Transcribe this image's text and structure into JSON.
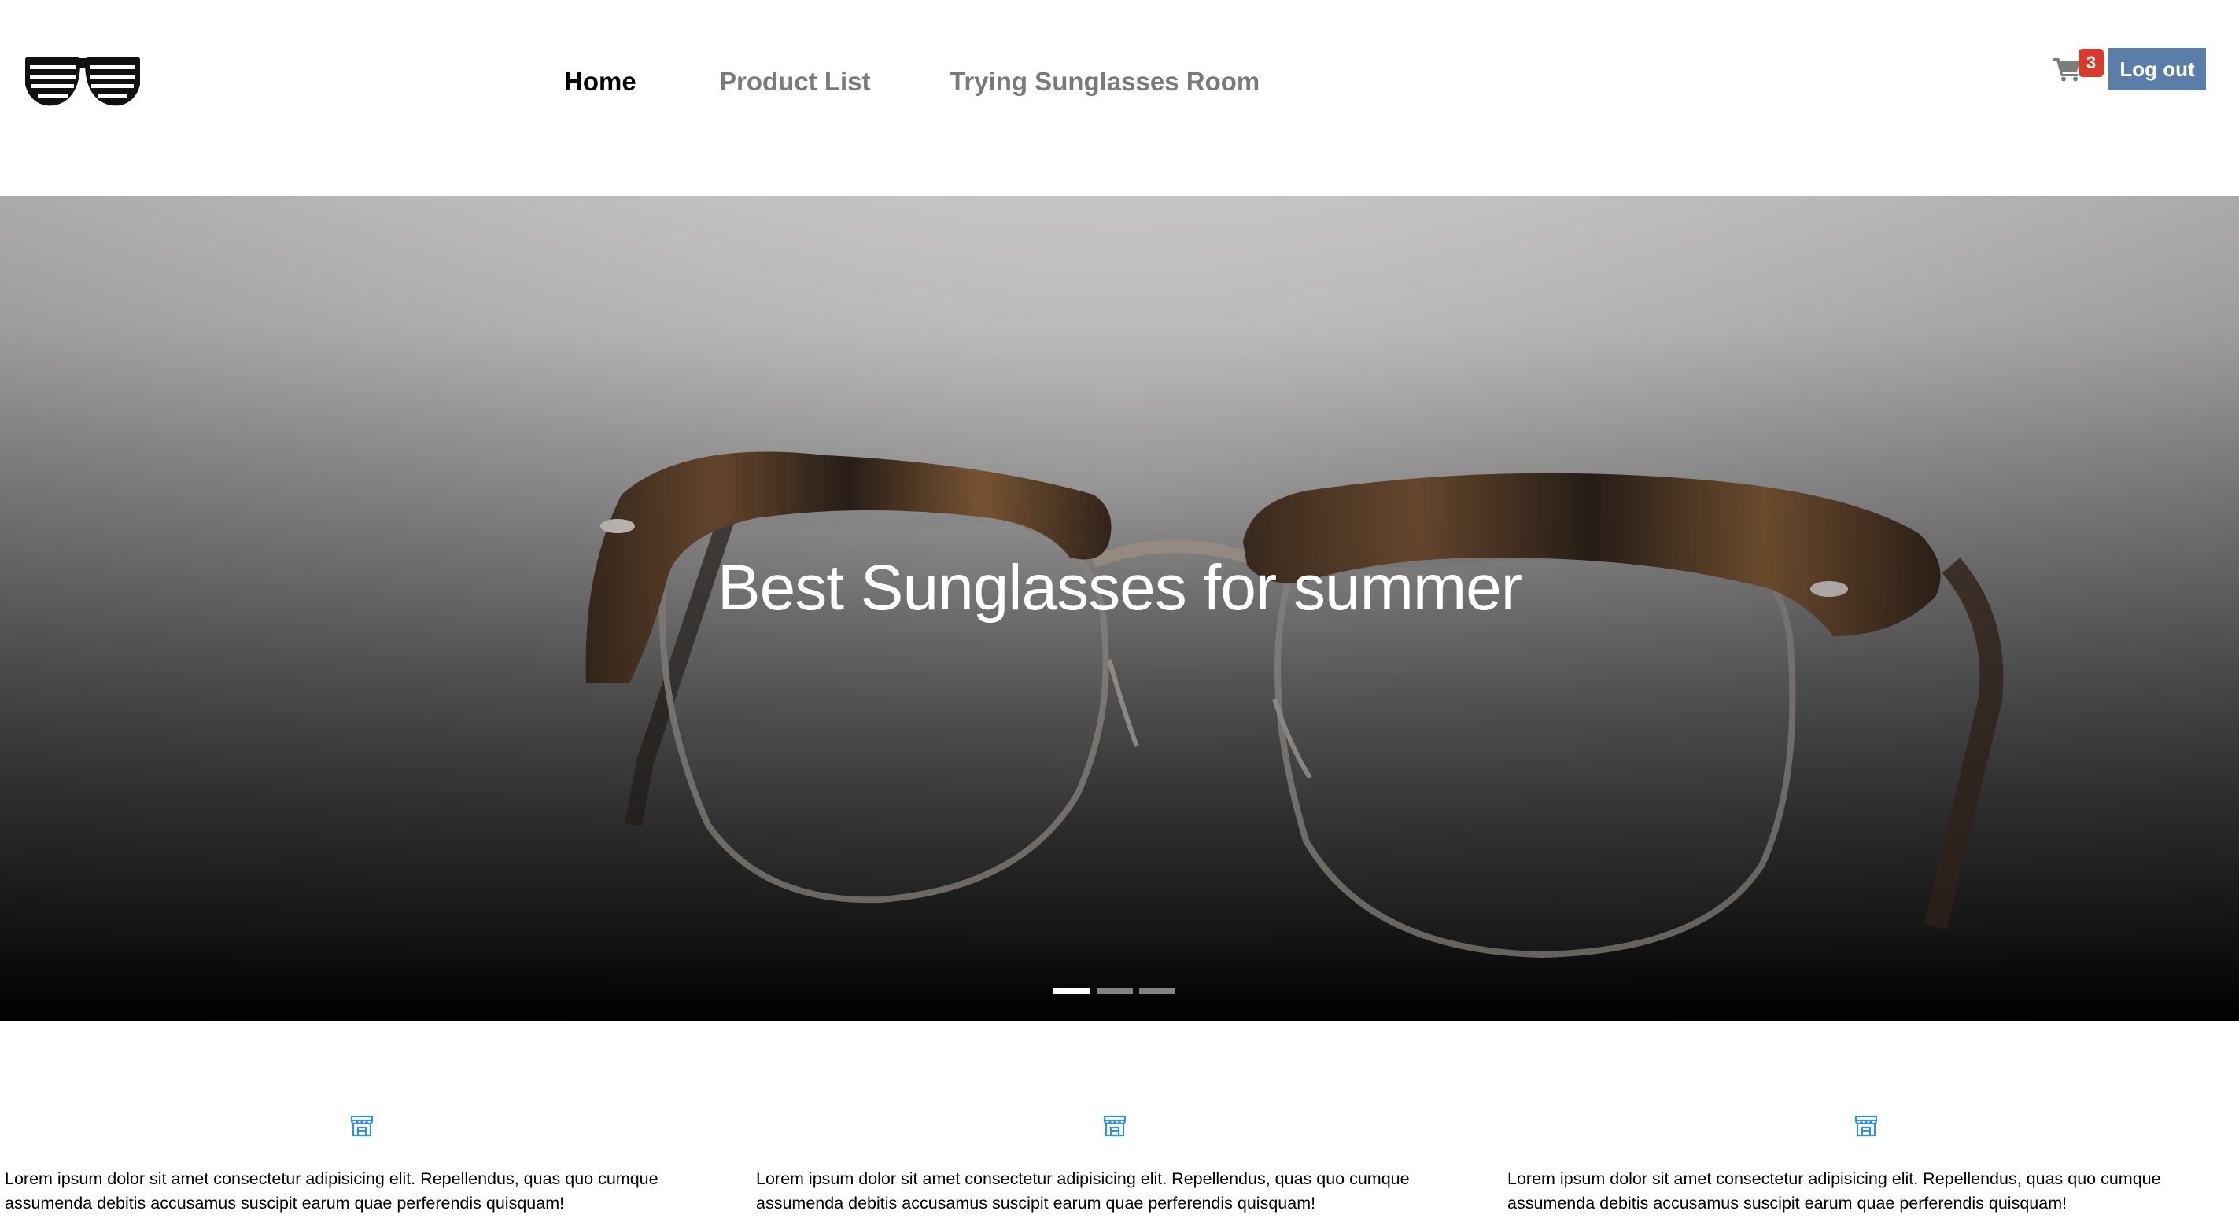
{
  "brand": {
    "logo_icon": "sunglasses-logo-icon"
  },
  "nav": {
    "items": [
      {
        "label": "Home",
        "active": true
      },
      {
        "label": "Product List",
        "active": false
      },
      {
        "label": "Trying Sunglasses Room",
        "active": false
      }
    ]
  },
  "cart": {
    "icon": "cart-icon",
    "count": "3"
  },
  "auth": {
    "logout_label": "Log out"
  },
  "hero": {
    "caption": "Best Sunglasses for summer",
    "slides_total": 3,
    "active_slide": 1
  },
  "features": [
    {
      "icon": "store-icon",
      "text": "Lorem ipsum dolor sit amet consectetur adipisicing elit. Repellendus, quas quo cumque assumenda debitis accusamus suscipit earum quae perferendis quisquam!"
    },
    {
      "icon": "store-icon",
      "text": "Lorem ipsum dolor sit amet consectetur adipisicing elit. Repellendus, quas quo cumque assumenda debitis accusamus suscipit earum quae perferendis quisquam!"
    },
    {
      "icon": "store-icon",
      "text": "Lorem ipsum dolor sit amet consectetur adipisicing elit. Repellendus, quas quo cumque assumenda debitis accusamus suscipit earum quae perferendis quisquam!"
    }
  ],
  "colors": {
    "accent": "#5a7ea9",
    "badge": "#d93a2b",
    "icon_blue": "#3b8fd6",
    "nav_inactive": "#7a7a7a"
  }
}
